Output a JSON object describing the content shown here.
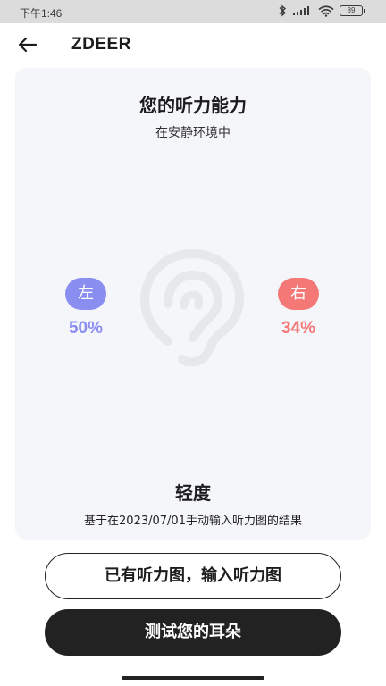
{
  "status_bar": {
    "time": "下午1:46",
    "battery": "89",
    "icons": [
      "bluetooth-icon",
      "signal-icon",
      "wifi-icon",
      "battery-icon"
    ]
  },
  "app_bar": {
    "title": "ZDEER",
    "back_icon": "arrow-left-icon"
  },
  "card": {
    "title": "您的听力能力",
    "subtitle": "在安静环境中",
    "ear_icon": "ear-icon",
    "left": {
      "label": "左",
      "percent": "50%",
      "color": "#8a8ef0"
    },
    "right": {
      "label": "右",
      "percent": "34%",
      "color": "#f47876"
    },
    "level": "轻度",
    "based_on": "基于在2023/07/01手动输入听力图的结果"
  },
  "buttons": {
    "input_audiogram": "已有听力图，输入听力图",
    "test_ears": "测试您的耳朵"
  },
  "colors": {
    "card_bg": "#f5f6fa",
    "primary_dark": "#222222"
  }
}
